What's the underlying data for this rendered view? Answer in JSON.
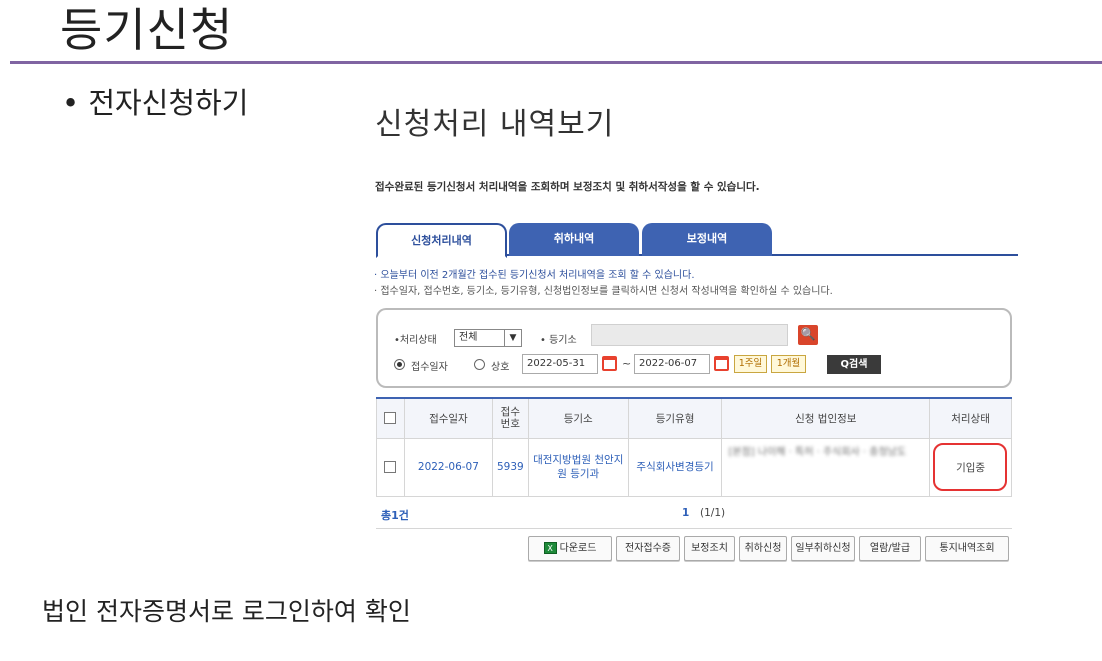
{
  "slide": {
    "title": "등기신청",
    "bullet": "• 전자신청하기",
    "caption": "법인 전자증명서로 로그인하여 확인"
  },
  "screen": {
    "title": "신청처리 내역보기",
    "description": "접수완료된 등기신청서 처리내역을 조회하며 보정조치 및 취하서작성을 할 수 있습니다.",
    "tabs": [
      {
        "label": "신청처리내역",
        "active": true
      },
      {
        "label": "취하내역",
        "active": false
      },
      {
        "label": "보정내역",
        "active": false
      }
    ],
    "notes": [
      "· 오늘부터 이전 2개월간 접수된 등기신청서 처리내역을 조회 할 수 있습니다.",
      "· 접수일자, 접수번호, 등기소, 등기유형, 신청법인정보를 클릭하시면 신청서 작성내역을 확인하실 수 있습니다."
    ],
    "search": {
      "status_label": "•처리상태",
      "status_value": "전체",
      "court_label": "• 등기소",
      "court_value": "",
      "radio_date": "접수일자",
      "radio_name": "상호",
      "date_from": "2022-05-31",
      "date_to": "2022-06-07",
      "tilde": "~",
      "period_1week": "1주일",
      "period_1month": "1개월",
      "search_button": "Q검색"
    },
    "table": {
      "headers": [
        "접수일자",
        "접수\n번호",
        "등기소",
        "등기유형",
        "신청 법인정보",
        "처리상태"
      ],
      "rows": [
        {
          "date": "2022-06-07",
          "receipt_no": "5939",
          "court": "대전지방법원 천안지원 등기과",
          "type": "주식회사변경등기",
          "corp_info": "[본점] 나이해 · 특허 · 주식회사 · 충청남도",
          "status": "기입중"
        }
      ]
    },
    "pager": {
      "total": "총1건",
      "current": "1",
      "info": "(1/1)"
    },
    "buttons": {
      "download": "다운로드",
      "receipt_cert": "전자접수증",
      "correction": "보정조치",
      "withdraw": "취하신청",
      "partial_withdraw": "일부취하신청",
      "view_issue": "열람/발급",
      "notice_query": "통지내역조회"
    }
  },
  "colors": {
    "accent_rule": "#8064a2",
    "tab_blue": "#3e63b2",
    "highlight_red": "#e53232"
  }
}
